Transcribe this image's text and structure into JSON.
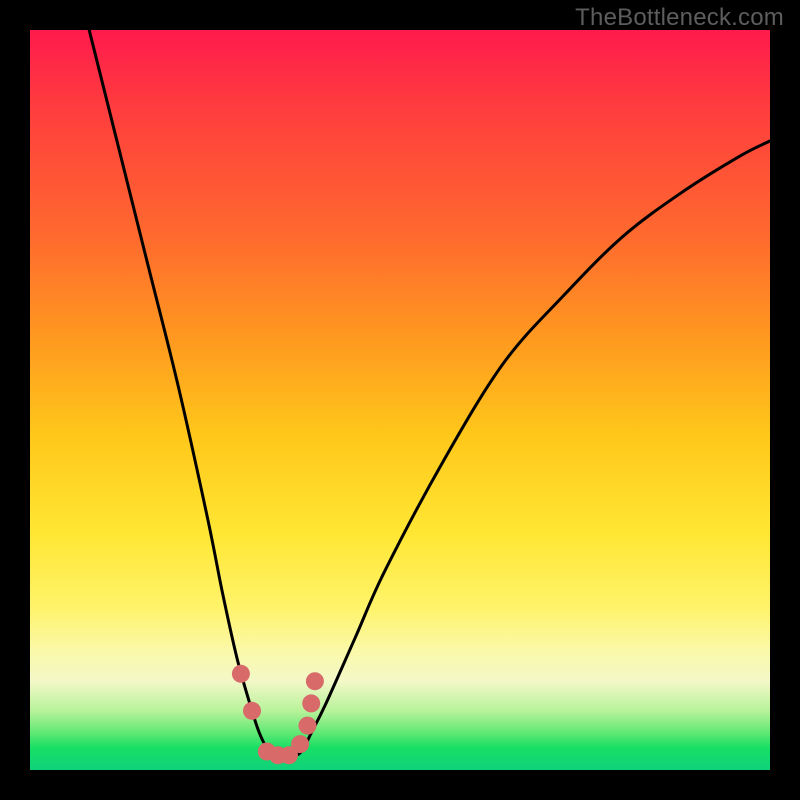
{
  "watermark": "TheBottleneck.com",
  "chart_data": {
    "type": "line",
    "title": "",
    "xlabel": "",
    "ylabel": "",
    "xlim": [
      0,
      100
    ],
    "ylim": [
      0,
      100
    ],
    "series": [
      {
        "name": "bottleneck-curve",
        "x": [
          8,
          12,
          16,
          20,
          24,
          26,
          28,
          30,
          31,
          32,
          33,
          34,
          36,
          37,
          38,
          40,
          44,
          48,
          56,
          64,
          72,
          80,
          88,
          96,
          100
        ],
        "values": [
          100,
          84,
          68,
          52,
          34,
          24,
          15,
          8,
          5,
          3,
          2,
          2,
          2,
          3,
          5,
          9,
          18,
          27,
          42,
          55,
          64,
          72,
          78,
          83,
          85
        ]
      }
    ],
    "markers": {
      "name": "highlight-points",
      "color": "#d86a6a",
      "x": [
        28.5,
        30.0,
        32.0,
        33.5,
        35.0,
        36.5,
        37.5,
        38.0,
        38.5
      ],
      "values": [
        13.0,
        8.0,
        2.5,
        2.0,
        2.0,
        3.5,
        6.0,
        9.0,
        12.0
      ]
    },
    "gradient_stops": [
      {
        "pos": 0,
        "color": "#ff1a4d"
      },
      {
        "pos": 28,
        "color": "#ff6a2e"
      },
      {
        "pos": 55,
        "color": "#ffc81a"
      },
      {
        "pos": 78,
        "color": "#fff36a"
      },
      {
        "pos": 92,
        "color": "#b8f29a"
      },
      {
        "pos": 100,
        "color": "#0fd17a"
      }
    ]
  }
}
